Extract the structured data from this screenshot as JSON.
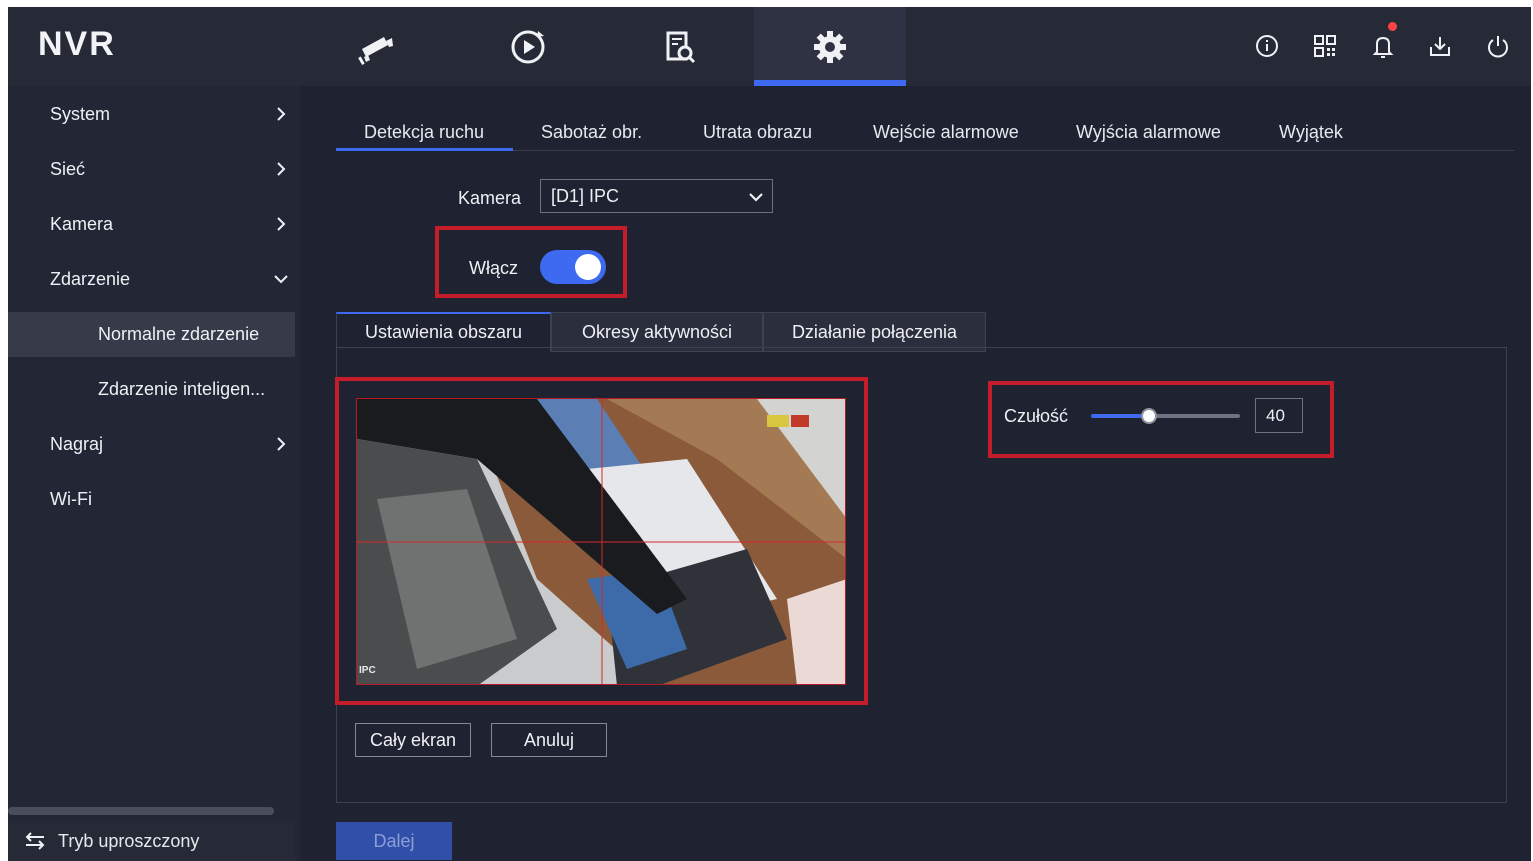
{
  "app": {
    "title": "NVR"
  },
  "topnav": {
    "tabs": [
      {
        "icon": "camera-icon",
        "active": false
      },
      {
        "icon": "playback-icon",
        "active": false
      },
      {
        "icon": "search-files-icon",
        "active": false
      },
      {
        "icon": "settings-gear-icon",
        "active": true
      }
    ],
    "right_icons": [
      "info-icon",
      "qr-code-icon",
      "bell-icon",
      "download-icon",
      "power-icon"
    ],
    "notification_dot": true
  },
  "sidebar": {
    "items": [
      {
        "label": "System",
        "chevron": "right"
      },
      {
        "label": "Sieć",
        "chevron": "right"
      },
      {
        "label": "Kamera",
        "chevron": "right"
      },
      {
        "label": "Zdarzenie",
        "chevron": "down"
      },
      {
        "label": "Normalne zdarzenie",
        "selected": true
      },
      {
        "label": "Zdarzenie inteligen..."
      },
      {
        "label": "Nagraj",
        "chevron": "right"
      },
      {
        "label": "Wi-Fi"
      }
    ],
    "bottom_label": "Tryb uproszczony"
  },
  "tabs": [
    "Detekcja ruchu",
    "Sabotaż obr.",
    "Utrata obrazu",
    "Wejście alarmowe",
    "Wyjścia alarmowe",
    "Wyjątek"
  ],
  "active_tab": "Detekcja ruchu",
  "form": {
    "camera_label": "Kamera",
    "camera_value": "[D1] IPC",
    "enable_label": "Włącz",
    "enable_on": true
  },
  "subtabs": [
    "Ustawienia obszaru",
    "Okresy aktywności",
    "Działanie połączenia"
  ],
  "preview": {
    "overlay_text": "IPC"
  },
  "sensitivity": {
    "label": "Czułość",
    "value": "40",
    "level_fraction": 0.4
  },
  "buttons": {
    "fullscreen": "Cały ekran",
    "cancel": "Anuluj",
    "next": "Dalej"
  },
  "colors": {
    "accent": "#3d6af0",
    "highlight_box": "#c41c28",
    "background": "#1f2331"
  }
}
